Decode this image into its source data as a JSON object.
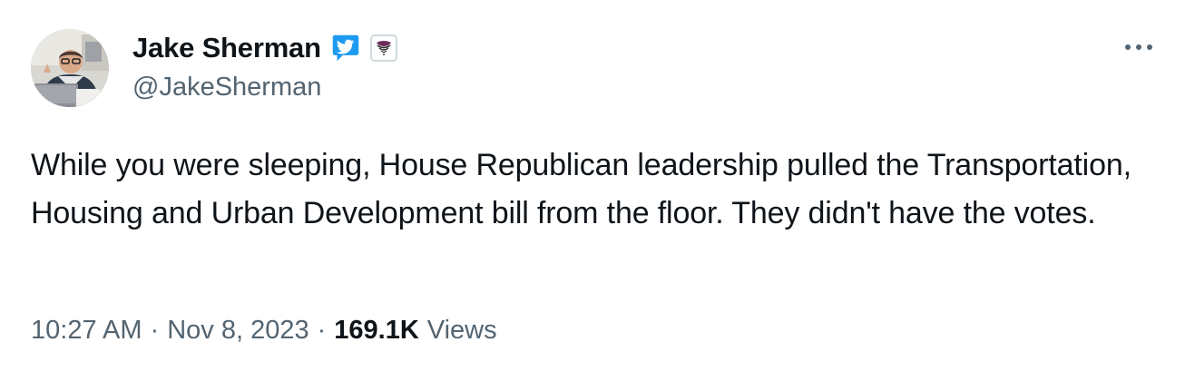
{
  "author": {
    "display_name": "Jake Sherman",
    "handle": "@JakeSherman",
    "verified_icon": "verified-badge-icon",
    "affiliate_icon": "affiliate-logo-icon",
    "avatar_icon": "profile-photo"
  },
  "menu": {
    "more_icon": "more-options-icon"
  },
  "tweet": {
    "text": "While you were sleeping, House Republican leadership pulled the Transportation, Housing and Urban Development bill from the floor. They didn't have the votes."
  },
  "meta": {
    "time": "10:27 AM",
    "separator": "·",
    "date": "Nov 8, 2023",
    "views_count": "169.1K",
    "views_label": "Views"
  },
  "colors": {
    "text_primary": "#0f1419",
    "text_secondary": "#536471",
    "verified_blue": "#1d9bf0",
    "background": "#ffffff"
  }
}
